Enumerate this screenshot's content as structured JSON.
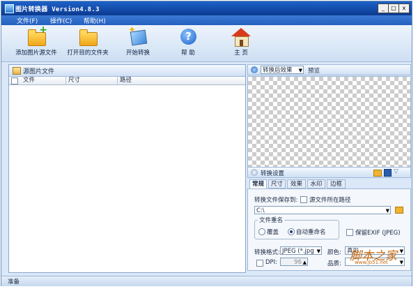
{
  "window": {
    "title": "图片转换器 Version4.8.3",
    "min": "_",
    "max": "□",
    "close": "x"
  },
  "menu": {
    "items": [
      "文件(F)",
      "操作(C)",
      "帮助(H)"
    ]
  },
  "toolbar": {
    "add_source": "添加图片源文件",
    "open_target": "打开目的文件夹",
    "start": "开始转换",
    "help": "帮 助",
    "home": "主 页"
  },
  "left_panel": {
    "title": "源图片文件",
    "columns": [
      "文件",
      "尺寸",
      "路径"
    ]
  },
  "preview": {
    "mode_select": "转换后效果",
    "label": "预览"
  },
  "settings": {
    "title": "转换设置",
    "tabs": [
      "常规",
      "尺寸",
      "效果",
      "水印",
      "边框"
    ],
    "save_to_label": "转换文件保存到:",
    "source_path_checkbox": "源文件所在路径",
    "path_value": "C:\\",
    "rename_group": "文件重名",
    "overwrite": "覆盖",
    "auto_rename": "自动重命名",
    "keep_exif": "保留EXIF (JPEG)",
    "format_label": "转换格式:",
    "format_value": "JPEG (*.jpg",
    "color_label": "颜色:",
    "color_value": "真彩",
    "dpi_label": "DPI:",
    "dpi_value": "96",
    "quality_label": "品质:"
  },
  "statusbar": {
    "text": "准备"
  },
  "watermark": {
    "text": "脚本之家",
    "url": "www.jb51.net"
  }
}
